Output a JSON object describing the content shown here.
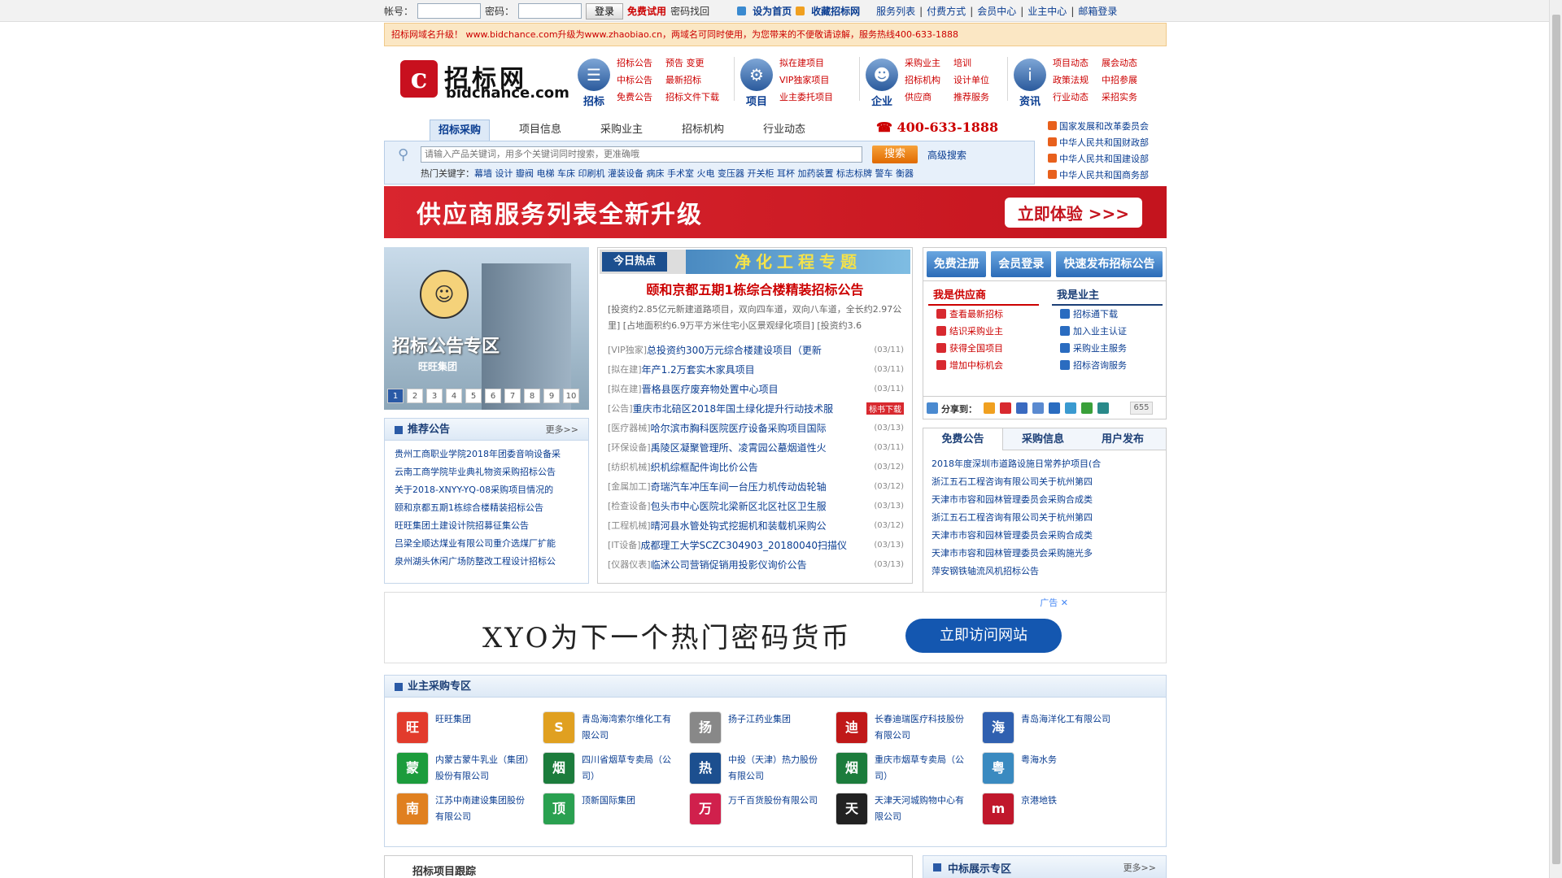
{
  "topbar": {
    "account_label": "帐号：",
    "password_label": "密码：",
    "login_button": "登录",
    "free_trial": "免费试用",
    "recover_password": "密码找回",
    "set_homepage": "设为首页",
    "bookmark": "收藏招标网",
    "links": [
      "服务列表",
      "付费方式",
      "会员中心",
      "业主中心",
      "邮箱登录"
    ]
  },
  "notice": "招标网域名升级！ www.bidchance.com升级为www.zhaobiao.cn，两域名可同时使用，为您带来的不便敬请谅解，服务热线400-633-1888",
  "header": {
    "logo_mark": "c",
    "logo_cn": "招标网",
    "logo_en": "bidchance.com",
    "nav_groups": [
      {
        "label": "招标",
        "icon": "document-icon",
        "links": [
          "招标公告",
          "预告 变更",
          "中标公告",
          "最新招标",
          "免费公告",
          "招标文件下载"
        ]
      },
      {
        "label": "项目",
        "icon": "gear-icon",
        "links": [
          "拟在建项目",
          "VIP独家项目",
          "业主委托项目"
        ]
      },
      {
        "label": "企业",
        "icon": "people-icon",
        "links": [
          "采购业主",
          "培训",
          "招标机构",
          "设计单位",
          "供应商",
          "推荐服务"
        ]
      },
      {
        "label": "资讯",
        "icon": "info-icon",
        "links": [
          "项目动态",
          "展会动态",
          "政策法规",
          "中招参展",
          "行业动态",
          "采招实务"
        ]
      }
    ]
  },
  "tabs": [
    "招标采购",
    "项目信息",
    "采购业主",
    "招标机构",
    "行业动态"
  ],
  "hotline": "400-633-1888",
  "search": {
    "placeholder": "请输入产品关键词，用多个关键词同时搜索，更准确哦",
    "button": "搜索",
    "advanced": "高级搜索",
    "hot_label": "热门关键字：",
    "hot_keywords": "幕墙 设计 瓣阀 电梯 车床 印刷机 灌装设备 病床 手术室 火电 变压器 开关柜 耳杯 加药装置 标志标牌 警车 衡器"
  },
  "gov_links": [
    "国家发展和改革委员会",
    "中华人民共和国财政部",
    "中华人民共和国建设部",
    "中华人民共和国商务部"
  ],
  "banner1": {
    "text": "供应商服务列表全新升级",
    "button": "立即体验 >>>"
  },
  "slideshow": {
    "title": "招标公告专区",
    "brand": "旺旺集团",
    "pages": [
      "1",
      "2",
      "3",
      "4",
      "5",
      "6",
      "7",
      "8",
      "9",
      "10"
    ]
  },
  "recommend": {
    "title": "推荐公告",
    "more": "更多>>",
    "items": [
      "贵州工商职业学院2018年团委音响设备采",
      "云南工商学院毕业典礼物资采购招标公告",
      "关于2018-XNYY-YQ-08采购项目情况的",
      "颐和京都五期1栋综合楼精装招标公告",
      "旺旺集团土建设计院招募征集公告",
      "吕梁全顺达煤业有限公司重介选煤厂扩能",
      "泉州湖头休闲广场防整改工程设计招标公"
    ]
  },
  "hot": {
    "badge": "今日热点",
    "banner": "净化工程专题",
    "headline": "颐和京都五期1栋综合楼精装招标公告",
    "summary": "[投资约2.85亿元新建道路项目，双向四车道，双向八车道，全长约2.97公里] [占地面积约6.9万平方米住宅小区景观绿化项目] [投资约3.6",
    "items": [
      {
        "cat": "[VIP独家]",
        "text": "总投资约300万元综合楼建设项目（更新",
        "date": "(03/11)",
        "tag": ""
      },
      {
        "cat": "[拟在建]",
        "text": "年产1.2万套实木家具项目",
        "date": "(03/11)",
        "tag": ""
      },
      {
        "cat": "[拟在建]",
        "text": "晋格县医疗废弃物处置中心项目",
        "date": "(03/11)",
        "tag": ""
      },
      {
        "cat": "[公告]",
        "text": "重庆市北碚区2018年国土绿化提升行动技术服",
        "date": "",
        "tag": "标书下载"
      },
      {
        "cat": "[医疗器械]",
        "text": "哈尔滨市胸科医院医疗设备采购项目国际",
        "date": "(03/13)",
        "tag": ""
      },
      {
        "cat": "[环保设备]",
        "text": "禹陵区凝聚管理所、凌霄园公墓烟道性火",
        "date": "(03/11)",
        "tag": ""
      },
      {
        "cat": "[纺织机械]",
        "text": "织机综框配件询比价公告",
        "date": "(03/12)",
        "tag": ""
      },
      {
        "cat": "[金属加工]",
        "text": "奇瑞汽车冲压车间一台压力机传动齿轮轴",
        "date": "(03/12)",
        "tag": ""
      },
      {
        "cat": "[检查设备]",
        "text": "包头市中心医院北梁新区北区社区卫生服",
        "date": "(03/13)",
        "tag": ""
      },
      {
        "cat": "[工程机械]",
        "text": "晴河县水管处钩式挖掘机和装载机采购公",
        "date": "(03/12)",
        "tag": ""
      },
      {
        "cat": "[IT设备]",
        "text": "成都理工大学SCZC304903_20180040扫描仪",
        "date": "(03/13)",
        "tag": ""
      },
      {
        "cat": "[仪器仪表]",
        "text": "临沭公司营销促销用投影仪询价公告",
        "date": "(03/13)",
        "tag": ""
      }
    ]
  },
  "right": {
    "buttons": [
      "免费注册",
      "会员登录",
      "快速发布招标公告"
    ],
    "supplier": {
      "title": "我是供应商",
      "items": [
        "查看最新招标",
        "结识采购业主",
        "获得全国项目",
        "增加中标机会"
      ]
    },
    "owner": {
      "title": "我是业主",
      "items": [
        "招标通下载",
        "加入业主认证",
        "采购业主服务",
        "招标咨询服务"
      ]
    },
    "share_label": "分享到：",
    "share_count": "655",
    "tabs": [
      "免费公告",
      "采购信息",
      "用户发布"
    ],
    "list": [
      "2018年度深圳市道路设施日常养护项目(合",
      "浙江五石工程咨询有限公司关于杭州第四",
      "天津市市容和园林管理委员会采购合成类",
      "浙江五石工程咨询有限公司关于杭州第四",
      "天津市市容和园林管理委员会采购合成类",
      "天津市市容和园林管理委员会采购施光多",
      "萍安钢铁轴流风机招标公告"
    ]
  },
  "ad2": {
    "text": "XYO为下一个热门密码货币",
    "button": "立即访问网站",
    "ad_label": "广告 ✕"
  },
  "owner_zone": {
    "title": "业主采购专区",
    "items": [
      {
        "name": "旺旺集团",
        "logo": "旺",
        "color": "#e23b2c"
      },
      {
        "name": "青岛海湾索尔维化工有限公司",
        "logo": "S",
        "color": "#e0a020"
      },
      {
        "name": "扬子江药业集团",
        "logo": "扬",
        "color": "#888888"
      },
      {
        "name": "长春迪瑞医疗科技股份有限公司",
        "logo": "迪",
        "color": "#c01818"
      },
      {
        "name": "青岛海洋化工有限公司",
        "logo": "海",
        "color": "#3060b0"
      },
      {
        "name": "内蒙古蒙牛乳业（集团）股份有限公司",
        "logo": "蒙",
        "color": "#1c9c3c"
      },
      {
        "name": "四川省烟草专卖局（公司）",
        "logo": "烟",
        "color": "#1c7c3c"
      },
      {
        "name": "中投（天津）热力股份有限公司",
        "logo": "热",
        "color": "#1c4f8f"
      },
      {
        "name": "重庆市烟草专卖局（公司）",
        "logo": "烟",
        "color": "#1c7c3c"
      },
      {
        "name": "粤海水务",
        "logo": "粤",
        "color": "#3a8ac0"
      },
      {
        "name": "江苏中南建设集团股份有限公司",
        "logo": "南",
        "color": "#e08020"
      },
      {
        "name": "顶新国际集团",
        "logo": "顶",
        "color": "#2aa050"
      },
      {
        "name": "万千百货股份有限公司",
        "logo": "万",
        "color": "#d0204c"
      },
      {
        "name": "天津天河城购物中心有限公司",
        "logo": "天",
        "color": "#222222"
      },
      {
        "name": "京港地铁",
        "logo": "m",
        "color": "#c0182c"
      }
    ]
  },
  "track_title": "招标项目跟踪",
  "win_zone": {
    "title": "中标展示专区",
    "more": "更多>>"
  }
}
